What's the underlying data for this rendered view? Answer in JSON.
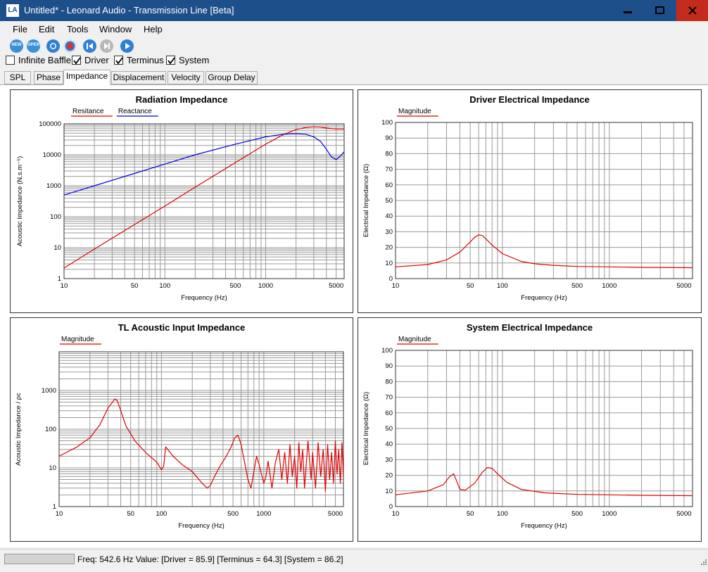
{
  "window": {
    "app_icon_text": "LA",
    "title": "Untitled* - Leonard Audio - Transmission Line [Beta]"
  },
  "menu": [
    "File",
    "Edit",
    "Tools",
    "Window",
    "Help"
  ],
  "toolbar": [
    {
      "name": "new-icon",
      "label": "NEW",
      "color": "#3a8fd8"
    },
    {
      "name": "open-icon",
      "label": "OPEN",
      "color": "#3a8fd8"
    },
    {
      "name": "record-blue-icon",
      "label": "",
      "color": "#2f7fd4"
    },
    {
      "name": "record-red-icon",
      "label": "",
      "color": "#d93030"
    },
    {
      "name": "step-back-icon",
      "label": "",
      "color": "#2f7fd4"
    },
    {
      "name": "step-forward-icon",
      "label": "",
      "color": "#b8b8b8"
    },
    {
      "name": "play-icon",
      "label": "",
      "color": "#2f7fd4"
    }
  ],
  "options": [
    {
      "label": "Infinite Baffle",
      "checked": false
    },
    {
      "label": "Driver",
      "checked": true
    },
    {
      "label": "Terminus",
      "checked": true
    },
    {
      "label": "System",
      "checked": true
    }
  ],
  "tabs": [
    {
      "label": "SPL",
      "active": false
    },
    {
      "label": "Phase",
      "active": false
    },
    {
      "label": "Impedance",
      "active": true
    },
    {
      "label": "Displacement",
      "active": false
    },
    {
      "label": "Velocity",
      "active": false
    },
    {
      "label": "Group Delay",
      "active": false
    }
  ],
  "status": {
    "text": "Freq: 542.6 Hz  Value: [Driver = 85.9]  [Terminus = 64.3]  [System = 86.2]"
  },
  "chart_data": [
    {
      "id": "radiation",
      "type": "line",
      "title": "Radiation Impedance",
      "xlabel": "Frequency (Hz)",
      "ylabel": "Acoustic Impedance (N.s.m⁻⁵)",
      "xscale": "log",
      "yscale": "log",
      "xlim": [
        10,
        6000
      ],
      "ylim": [
        1,
        100000
      ],
      "xticks": [
        10,
        50,
        100,
        500,
        1000,
        5000
      ],
      "yticks": [
        1,
        10,
        100,
        1000,
        10000,
        100000
      ],
      "legend": "top-left",
      "series": [
        {
          "name": "Resitance",
          "color": "#e00000",
          "x": [
            10,
            20,
            50,
            100,
            200,
            500,
            1000,
            1500,
            2000,
            2500,
            3000,
            3500,
            4000,
            5000,
            6000
          ],
          "y": [
            2.2,
            9,
            56,
            220,
            900,
            5600,
            22000,
            45000,
            65000,
            76000,
            80000,
            78000,
            73000,
            68000,
            68000
          ]
        },
        {
          "name": "Reactance",
          "color": "#0000e0",
          "x": [
            10,
            20,
            50,
            100,
            200,
            500,
            1000,
            1500,
            2000,
            2500,
            3000,
            3500,
            4000,
            4500,
            5000,
            5500,
            6000
          ],
          "y": [
            500,
            1000,
            2500,
            5000,
            10000,
            22000,
            38000,
            46000,
            48000,
            46000,
            38000,
            27000,
            15000,
            8500,
            7000,
            9000,
            12500
          ]
        }
      ]
    },
    {
      "id": "driver",
      "type": "line",
      "title": "Driver Electrical Impedance",
      "xlabel": "Frequency (Hz)",
      "ylabel": "Electrical Impedance (Ω)",
      "xscale": "log",
      "yscale": "linear",
      "xlim": [
        10,
        6000
      ],
      "ylim": [
        0,
        100
      ],
      "xticks": [
        10,
        50,
        100,
        500,
        1000,
        5000
      ],
      "yticks": [
        0,
        10,
        20,
        30,
        40,
        50,
        60,
        70,
        80,
        90,
        100
      ],
      "legend": "top-left",
      "series": [
        {
          "name": "Magnitude",
          "color": "#e00000",
          "x": [
            10,
            20,
            30,
            40,
            50,
            55,
            60,
            65,
            70,
            80,
            100,
            150,
            200,
            300,
            500,
            1000,
            2000,
            6000
          ],
          "y": [
            7.5,
            9,
            12,
            17,
            23.5,
            26.5,
            28,
            27.5,
            25.5,
            21.5,
            16,
            11,
            9.5,
            8.5,
            7.8,
            7.5,
            7.2,
            7
          ]
        }
      ]
    },
    {
      "id": "tl",
      "type": "line",
      "title": "TL Acoustic Input Impedance",
      "xlabel": "Frequency (Hz)",
      "ylabel": "Acoustic Impedance / ρc",
      "xscale": "log",
      "yscale": "log",
      "xlim": [
        10,
        6000
      ],
      "ylim": [
        1,
        10000
      ],
      "xticks": [
        10,
        50,
        100,
        500,
        1000,
        5000
      ],
      "yticks": [
        1,
        10,
        100,
        1000
      ],
      "legend": "top-left",
      "series": [
        {
          "name": "Magnitude",
          "color": "#e00000",
          "x": [
            10,
            15,
            20,
            25,
            30,
            35,
            37,
            40,
            45,
            55,
            70,
            90,
            100,
            105,
            110,
            130,
            160,
            200,
            250,
            280,
            300,
            330,
            380,
            420,
            480,
            520,
            560,
            600,
            700,
            750,
            800,
            850,
            900,
            1000,
            1050,
            1100,
            1200,
            1300,
            1400,
            1500,
            1600,
            1700,
            1800,
            1900,
            2000,
            2100,
            2200,
            2300,
            2400,
            2500,
            2700,
            2900,
            3000,
            3200,
            3400,
            3600,
            3800,
            4000,
            4200,
            4400,
            4600,
            4800,
            5000,
            5200,
            5400,
            5600,
            5800,
            6000
          ],
          "y": [
            20,
            35,
            60,
            130,
            350,
            600,
            550,
            300,
            120,
            50,
            25,
            14,
            9,
            11,
            35,
            20,
            12,
            8,
            4,
            3,
            3.5,
            6,
            12,
            18,
            35,
            60,
            70,
            40,
            5,
            3,
            8,
            20,
            12,
            4,
            6,
            15,
            3,
            14,
            30,
            5,
            25,
            4,
            40,
            6,
            20,
            3,
            45,
            8,
            30,
            3,
            50,
            5,
            25,
            3,
            45,
            6,
            30,
            2.5,
            40,
            5,
            25,
            4,
            50,
            7,
            30,
            4,
            45,
            6
          ]
        }
      ]
    },
    {
      "id": "system",
      "type": "line",
      "title": "System Electrical Impedance",
      "xlabel": "Frequency (Hz)",
      "ylabel": "Electrical Impedance (Ω)",
      "xscale": "log",
      "yscale": "linear",
      "xlim": [
        10,
        6000
      ],
      "ylim": [
        0,
        100
      ],
      "xticks": [
        10,
        50,
        100,
        500,
        1000,
        5000
      ],
      "yticks": [
        0,
        10,
        20,
        30,
        40,
        50,
        60,
        70,
        80,
        90,
        100
      ],
      "legend": "top-left",
      "series": [
        {
          "name": "Magnitude",
          "color": "#e00000",
          "x": [
            10,
            20,
            28,
            32,
            35,
            37,
            40,
            45,
            55,
            65,
            72,
            80,
            90,
            110,
            150,
            250,
            500,
            1000,
            2000,
            6000
          ],
          "y": [
            7.5,
            10,
            14,
            19,
            21,
            17,
            11,
            10.5,
            15,
            22,
            25,
            24.5,
            21,
            15.5,
            11,
            8.8,
            7.8,
            7.5,
            7.2,
            7
          ]
        }
      ]
    }
  ]
}
